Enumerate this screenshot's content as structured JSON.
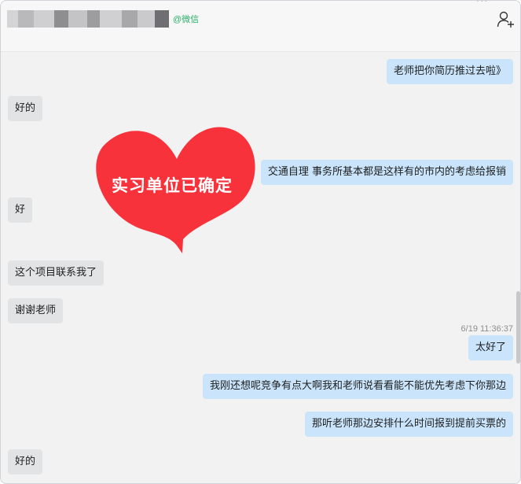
{
  "header": {
    "source_tag": "@微信",
    "more": "···"
  },
  "messages": {
    "m1": "老师把你简历推过去啦》",
    "m2": "好的",
    "m3": "交通自理 事务所基本都是这样有的市内的考虑给报销",
    "m4": "好",
    "m5": "这个项目联系我了",
    "m6": "谢谢老师",
    "timestamp": "6/19 11:36:37",
    "m7": "太好了",
    "m8": "我刚还想呢竞争有点大啊我和老师说看看能不能优先考虑下你那边",
    "m9": "那听老师那边安排什么时间报到提前买票的",
    "m10": "好的"
  },
  "sticker": {
    "text": "实习单位已确定",
    "color": "#f7323b"
  },
  "colors": {
    "incoming_bubble": "#e2e3e5",
    "outgoing_bubble": "#c9e4fb",
    "wechat_green": "#2aae67"
  }
}
